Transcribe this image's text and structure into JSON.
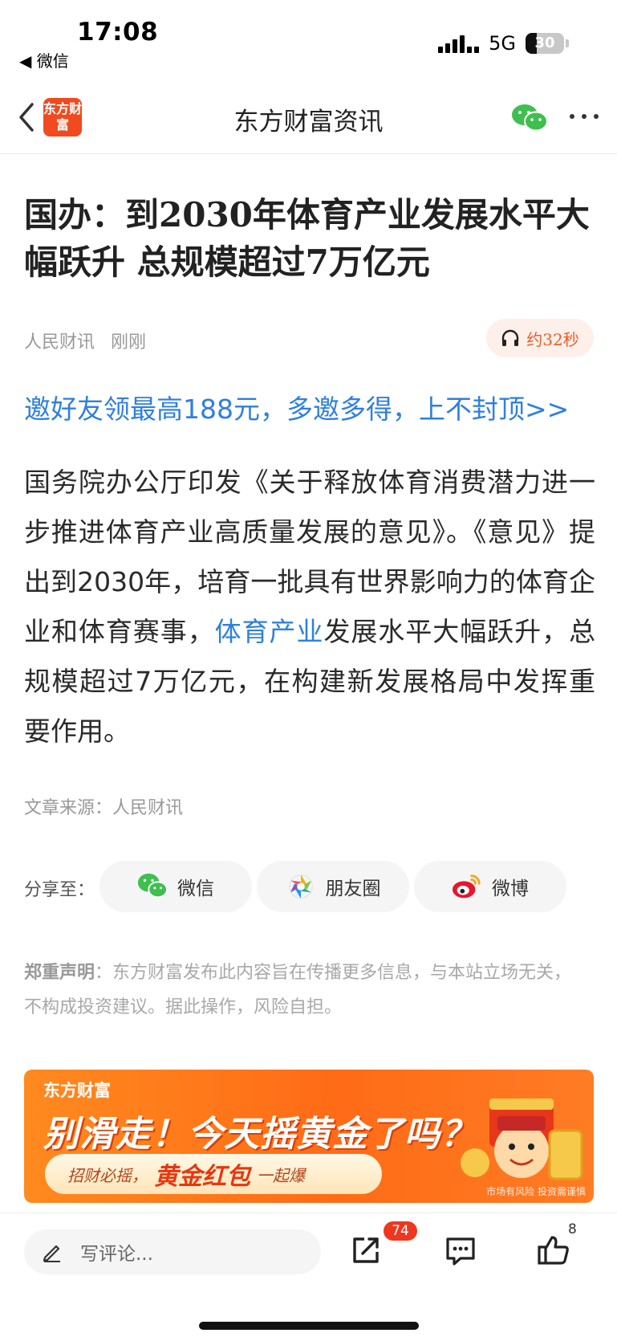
{
  "status_bar": {
    "time": "17:08",
    "back_app": "◀ 微信",
    "network": "5G",
    "battery": "30",
    "battery_level": 0.3
  },
  "nav": {
    "logo_text": "东方财富",
    "title": "东方财富资讯"
  },
  "article": {
    "headline": "国办：到2030年体育产业发展水平大幅跃升 总规模超过7万亿元",
    "source_name": "人民财讯",
    "time": "刚刚",
    "audio_label": "约32秒",
    "promo_link": "邀好友领最高188元，多邀多得，上不封顶>>",
    "body_part1": "国务院办公厅印发《关于释放体育消费潜力进一步推进体育产业高质量发展的意见》。《意见》提出到2030年，培育一批具有世界影响力的体育企业和体育赛事，",
    "body_link": "体育产业",
    "body_part2": "发展水平大幅跃升，总规模超过7万亿元，在构建新发展格局中发挥重要作用。",
    "source_line": "文章来源：人民财讯"
  },
  "share": {
    "label": "分享至：",
    "wechat": "微信",
    "moments": "朋友圈",
    "weibo": "微博"
  },
  "disclaimer": {
    "title": "郑重声明",
    "text": "：东方财富发布此内容旨在传播更多信息，与本站立场无关，不构成投资建议。据此操作，风险自担。"
  },
  "banner": {
    "brand": "东方财富",
    "headline": "别滑走！今天摇黄金了吗？",
    "pill_prefix": "招财必摇，",
    "pill_big": "黄金红包",
    "pill_suffix": "一起爆",
    "footnote": "市场有风险 投资需谨慎"
  },
  "bottom_bar": {
    "comment_placeholder": "写评论...",
    "share_count": "74",
    "like_count": "8"
  },
  "colors": {
    "accent_blue": "#2f7fe0",
    "brand_orange": "#f04b1f",
    "badge_red": "#f0361e"
  },
  "icons": [
    "chevron-left-icon",
    "wechat-icon",
    "more-icon",
    "headphone-icon",
    "moments-icon",
    "weibo-icon",
    "pencil-icon",
    "share-out-icon",
    "comment-icon",
    "thumb-up-icon"
  ]
}
